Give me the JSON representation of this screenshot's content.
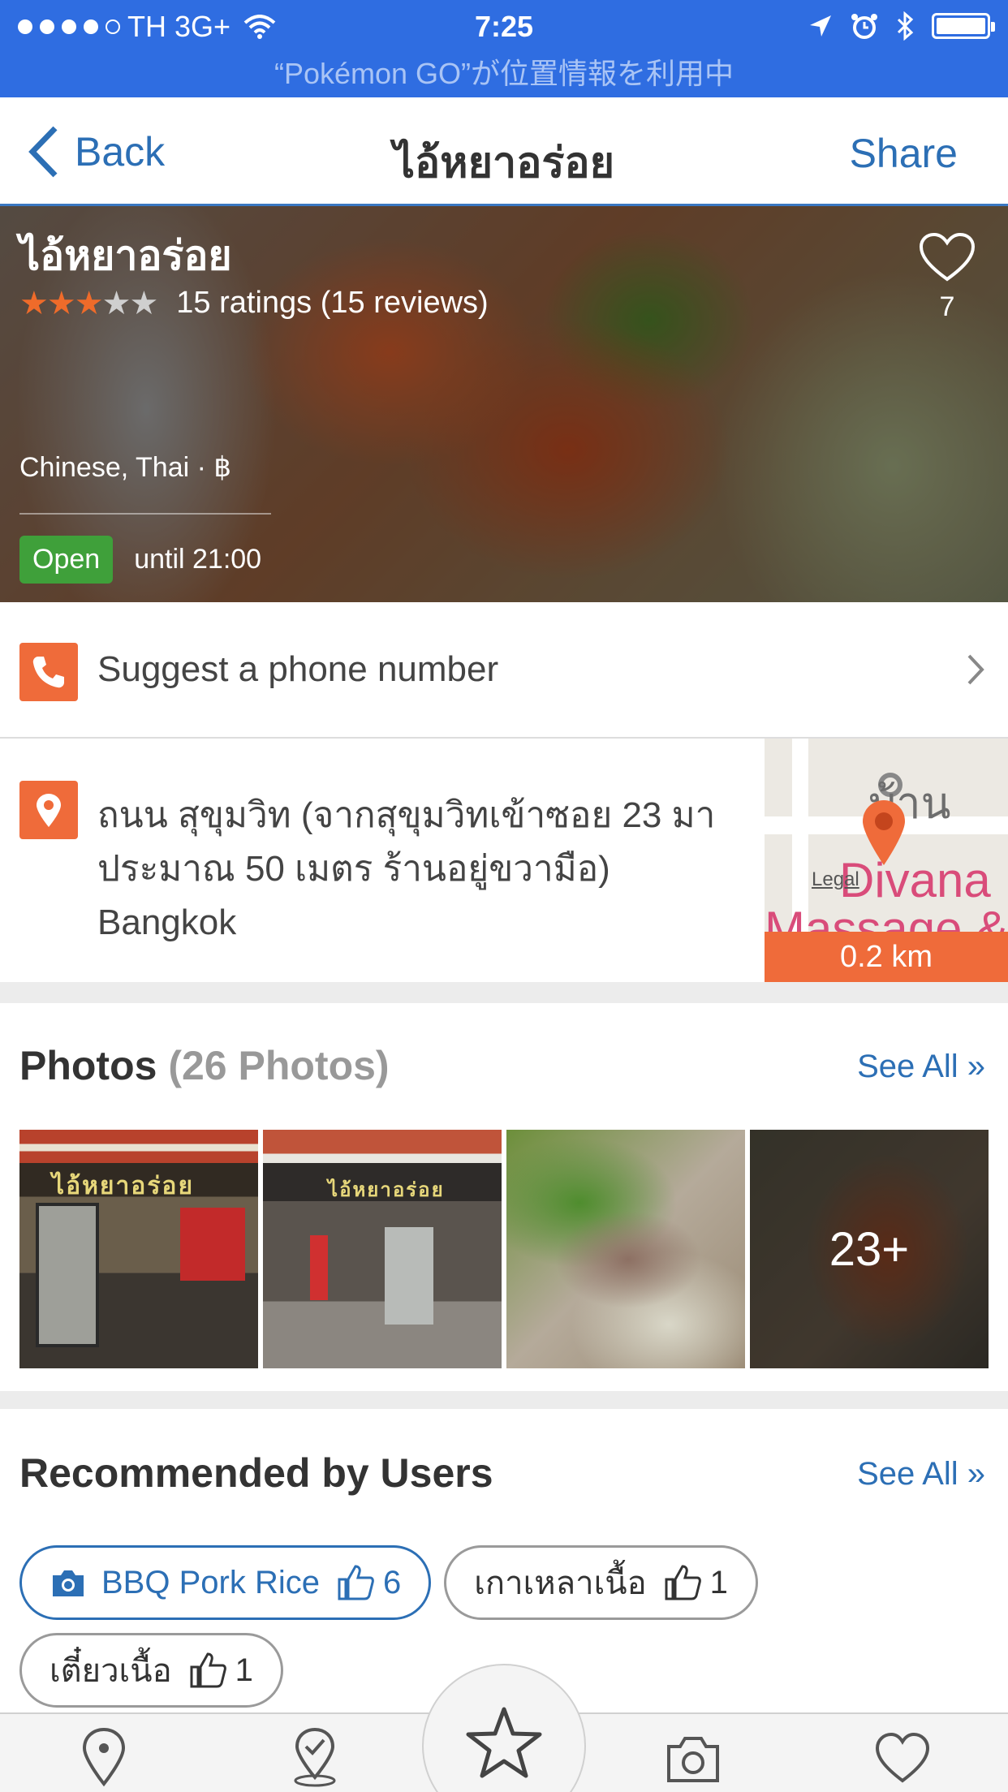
{
  "status_bar": {
    "carrier": "TH 3G+",
    "time": "7:25",
    "location_banner": "“Pokémon GO”が位置情報を利用中"
  },
  "nav": {
    "back_label": "Back",
    "title": "ไอ้หยาอร่อย",
    "share_label": "Share"
  },
  "restaurant": {
    "name": "ไอ้หยาอร่อย",
    "rating_stars": 3,
    "rating_max": 5,
    "ratings_text": "15 ratings (15 reviews)",
    "favorites_count": "7",
    "cuisine": "Chinese, Thai · ฿",
    "open_status": "Open",
    "hours": "until 21:00"
  },
  "phone": {
    "label": "Suggest a phone number"
  },
  "address": {
    "line1": "ถนน สุขุมวิท (จากสุขุมวิทเข้าซอย 23 มา",
    "line2": "ประมาณ 50 เมตร ร้านอยู่ขวามือ)",
    "city": "Bangkok"
  },
  "map": {
    "poi_label": "บ้าน",
    "place_label": "Divana",
    "place_label_2": "Massage &",
    "legal": "Legal",
    "distance": "0.2 km"
  },
  "photos": {
    "title": "Photos",
    "count_text": "(26 Photos)",
    "see_all": "See All »",
    "sign_text": "ไอ้หยาอร่อย",
    "more_overlay": "23+"
  },
  "recommended": {
    "title": "Recommended by Users",
    "see_all": "See All »",
    "items": [
      {
        "name": "BBQ Pork Rice",
        "likes": "6"
      },
      {
        "name": "เกาเหลาเนื้อ",
        "likes": "1"
      },
      {
        "name": "เตี๋ยวเนื้อ",
        "likes": "1"
      }
    ]
  },
  "tab_bar": {
    "icons": [
      "map-pin-icon",
      "check-in-icon",
      "star-icon",
      "camera-icon",
      "heart-icon"
    ]
  },
  "colors": {
    "status_bar": "#2f6de1",
    "link": "#2c6fb5",
    "accent_orange": "#ef6b3a",
    "star_orange": "#ef6b2a",
    "open_green": "#3fa03a"
  }
}
